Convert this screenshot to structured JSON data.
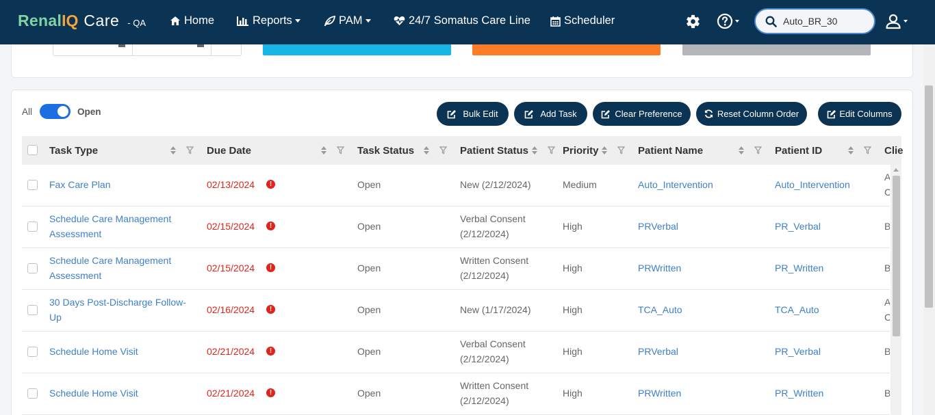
{
  "brand": {
    "part1": "Renal",
    "part2": "IQ",
    "part3": "Care",
    "env": "- QA"
  },
  "nav": {
    "home": "Home",
    "reports": "Reports",
    "pam": "PAM",
    "careline": "24/7 Somatus Care Line",
    "scheduler": "Scheduler"
  },
  "search": {
    "value": "Auto_BR_30",
    "placeholder": "Search"
  },
  "toggle": {
    "left_label": "All",
    "right_label": "Open",
    "state": "Open"
  },
  "toolbar": {
    "bulk_edit": "Bulk Edit",
    "add_task": "Add Task",
    "clear_preference": "Clear Preference",
    "reset_column_order": "Reset Column Order",
    "edit_columns": "Edit Columns"
  },
  "table": {
    "columns": [
      "Task Type",
      "Due Date",
      "Task Status",
      "Patient Status",
      "Priority",
      "Patient Name",
      "Patient ID",
      "Clie"
    ],
    "rows": [
      {
        "task_type": "Fax Care Plan",
        "due_date": "02/13/2024",
        "task_status": "Open",
        "patient_status": "New (2/12/2024)",
        "priority": "Medium",
        "patient_name": "Auto_Intervention",
        "patient_id": "Auto_Intervention",
        "client": "A\nC"
      },
      {
        "task_type": "Schedule Care Management Assessment",
        "due_date": "02/15/2024",
        "task_status": "Open",
        "patient_status": "Verbal Consent (2/12/2024)",
        "priority": "High",
        "patient_name": "PRVerbal",
        "patient_id": "PR_Verbal",
        "client": "B"
      },
      {
        "task_type": "Schedule Care Management Assessment",
        "due_date": "02/15/2024",
        "task_status": "Open",
        "patient_status": "Written Consent (2/12/2024)",
        "priority": "High",
        "patient_name": "PRWritten",
        "patient_id": "PR_Written",
        "client": "B"
      },
      {
        "task_type": "30 Days Post-Discharge Follow-Up",
        "due_date": "02/16/2024",
        "task_status": "Open",
        "patient_status": "New (1/17/2024)",
        "priority": "High",
        "patient_name": "TCA_Auto",
        "patient_id": "TCA_Auto",
        "client": "A\nC"
      },
      {
        "task_type": "Schedule Home Visit",
        "due_date": "02/21/2024",
        "task_status": "Open",
        "patient_status": "Verbal Consent (2/12/2024)",
        "priority": "High",
        "patient_name": "PRVerbal",
        "patient_id": "PR_Verbal",
        "client": "B"
      },
      {
        "task_type": "Schedule Home Visit",
        "due_date": "02/21/2024",
        "task_status": "Open",
        "patient_status": "Written Consent (2/12/2024)",
        "priority": "High",
        "patient_name": "PRWritten",
        "patient_id": "PR_Written",
        "client": "B"
      }
    ]
  },
  "colors": {
    "navbar": "#0b3354",
    "link": "#3f80c8",
    "overdue": "#e0241b",
    "toggle_on": "#1b6fe0",
    "tile_blue": "#17b5e8",
    "tile_orange": "#fd7c28",
    "tile_gray": "#b4b5b8"
  }
}
